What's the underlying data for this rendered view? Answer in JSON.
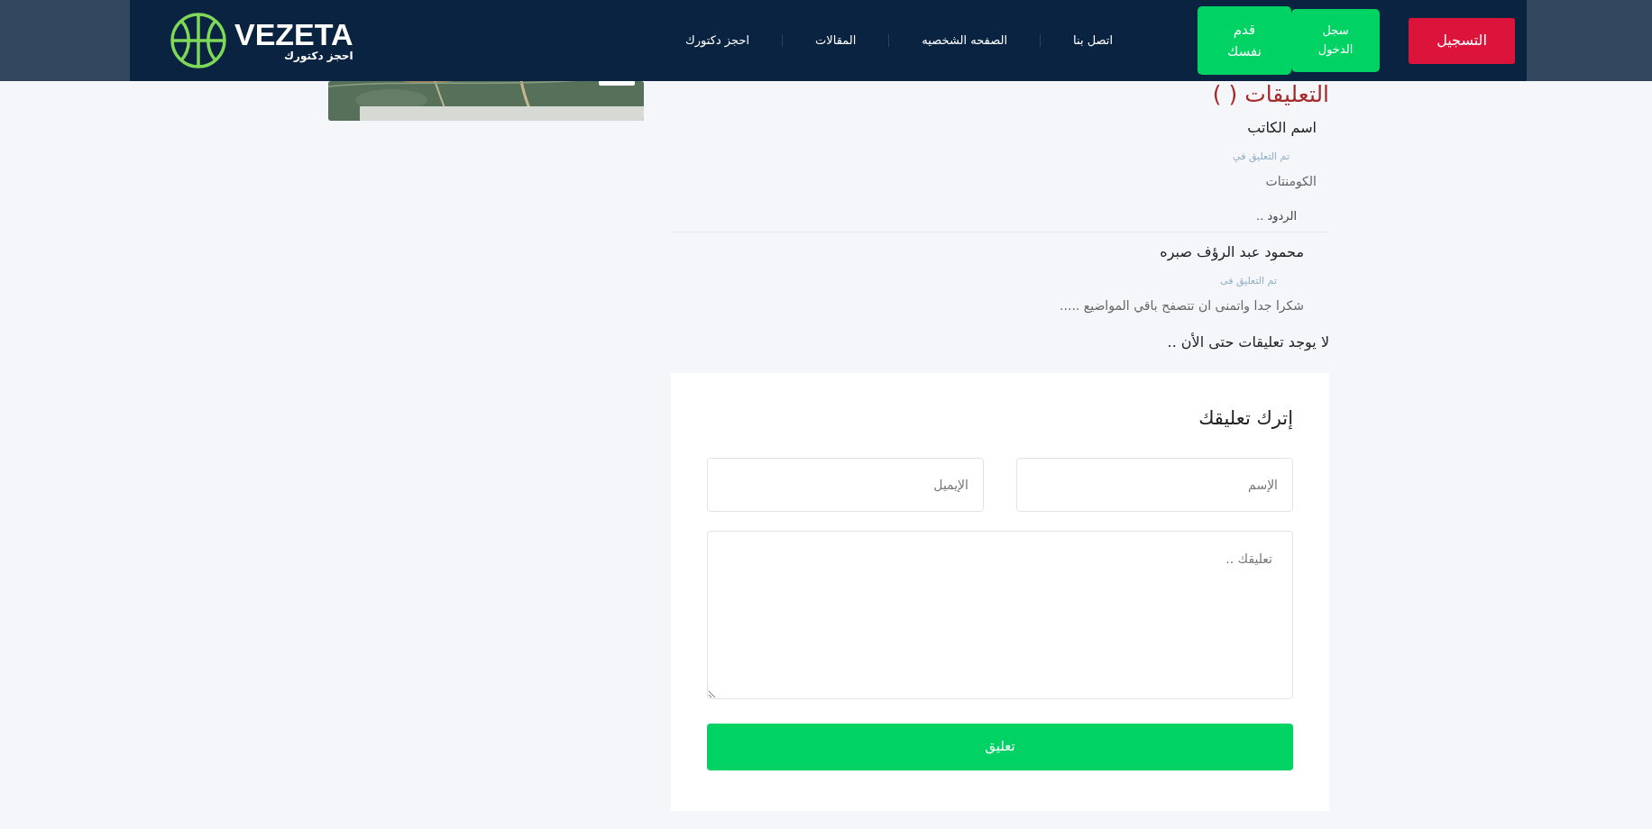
{
  "header": {
    "logo": {
      "title": "VEZETA",
      "subtitle": "احجز دكتورك"
    },
    "nav": [
      {
        "label": "اتصل بنا"
      },
      {
        "label": "الصفحه الشخصيه"
      },
      {
        "label": "المقالات"
      },
      {
        "label": "احجز دكتورك"
      }
    ],
    "buttons": [
      {
        "label": "التسجيل",
        "kind": "red"
      },
      {
        "label": "سجل الدخول",
        "kind": "green"
      },
      {
        "label": "قدم نفسك",
        "kind": "green-tall"
      }
    ]
  },
  "comments": {
    "title": "التعليقات ( )",
    "items": [
      {
        "author": "اسم الكاتب",
        "meta": "تم التعليق في",
        "text": "الكومنتات",
        "replies_label": "الردود ..",
        "replies": [
          {
            "author": "محمود عبد الرؤف صبره",
            "meta": "تم التعليق فى",
            "text": "شكرا جدا واتمنى ان تتصفح باقي المواضيع ....."
          }
        ]
      }
    ],
    "empty_note": "لا يوجد تعليقات حتى الأن .."
  },
  "form": {
    "title": "إترك تعليقك",
    "name": {
      "placeholder": "الإسم"
    },
    "email": {
      "placeholder": "الإيميل"
    },
    "comment": {
      "placeholder": "تعليقك .."
    },
    "submit": "تعليق"
  }
}
